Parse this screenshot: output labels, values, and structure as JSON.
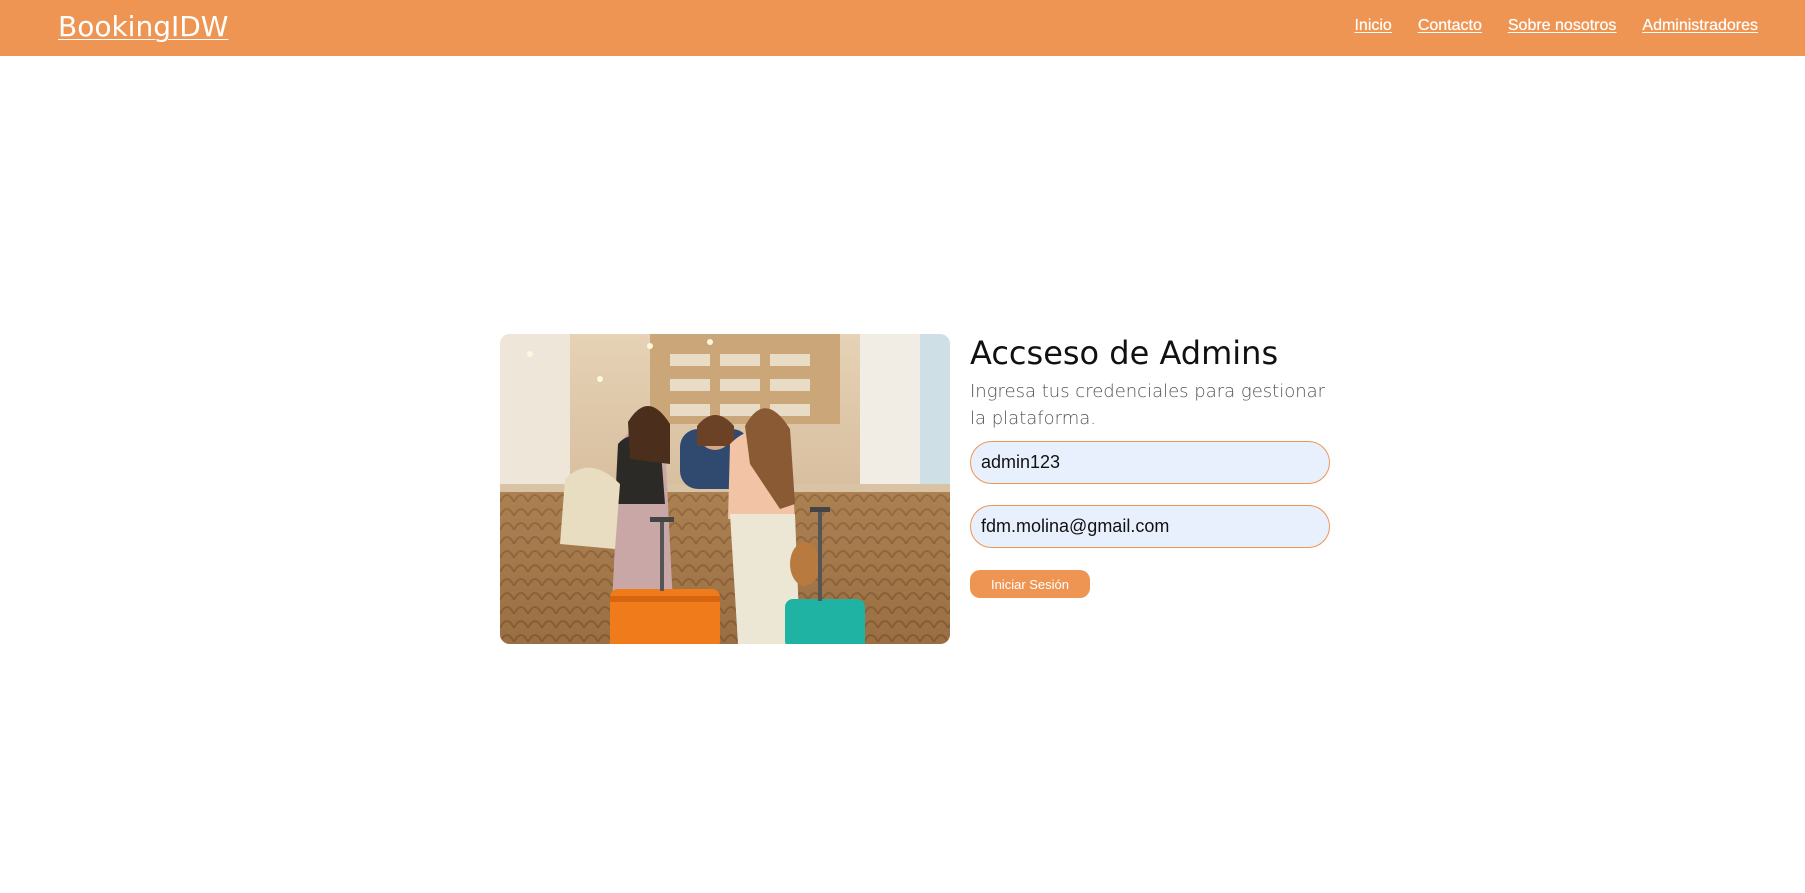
{
  "navbar": {
    "brand": "BookingIDW",
    "links": [
      {
        "label": "Inicio"
      },
      {
        "label": "Contacto"
      },
      {
        "label": "Sobre nosotros"
      },
      {
        "label": "Administradores"
      }
    ],
    "background_color": "#ef9553"
  },
  "login": {
    "title": "Accseso de Admins",
    "subtitle": "Ingresa tus credenciales para gestionar la plataforma.",
    "username_value": "admin123",
    "email_value": "fdm.molina@gmail.com",
    "submit_label": "Iniciar Sesión",
    "accent_color": "#ef9553",
    "input_background": "#e8f0fe"
  }
}
